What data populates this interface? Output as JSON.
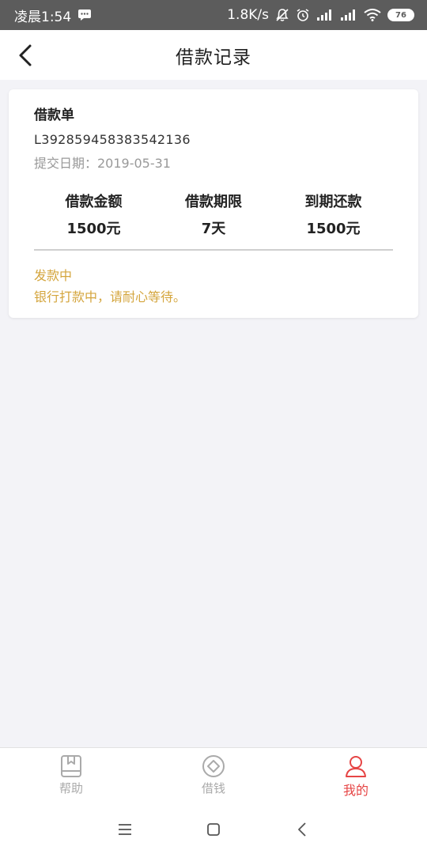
{
  "status_bar": {
    "time": "凌晨1:54",
    "speed": "1.8K/s",
    "battery": "76"
  },
  "header": {
    "title": "借款记录"
  },
  "loan": {
    "section_title": "借款单",
    "order_number": "L392859458383542136",
    "submit_date": "提交日期：2019-05-31",
    "stats": [
      {
        "label": "借款金额",
        "value": "1500元"
      },
      {
        "label": "借款期限",
        "value": "7天"
      },
      {
        "label": "到期还款",
        "value": "1500元"
      }
    ],
    "status_title": "发款中",
    "status_desc": "银行打款中，请耐心等待。"
  },
  "tabbar": {
    "items": [
      {
        "label": "帮助",
        "icon": "book-icon",
        "active": false
      },
      {
        "label": "借钱",
        "icon": "coin-icon",
        "active": false
      },
      {
        "label": "我的",
        "icon": "user-icon",
        "active": true
      }
    ]
  },
  "colors": {
    "accent": "#e64545",
    "status": "#d4a53d",
    "inactive": "#aaaaaa"
  }
}
